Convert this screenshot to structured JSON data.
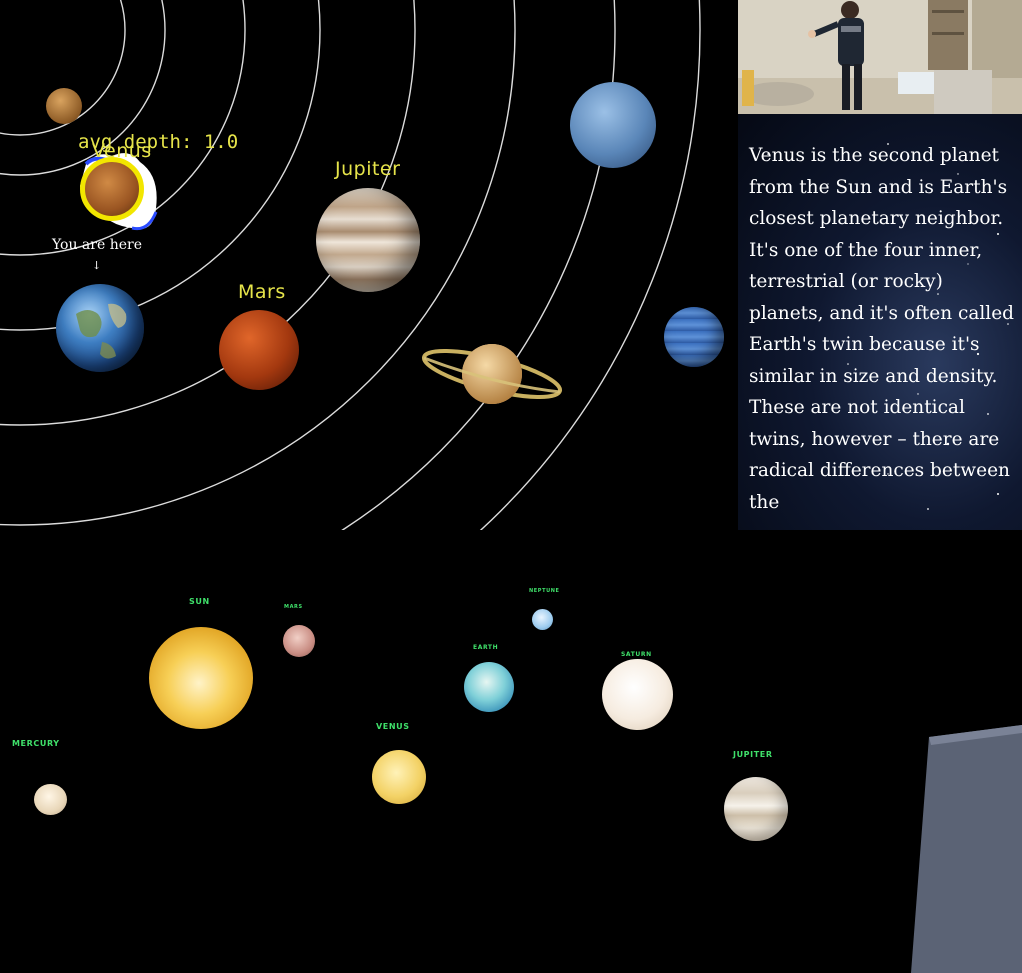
{
  "top_view": {
    "labels": {
      "venus": "Venus",
      "jupiter": "Jupiter",
      "mars": "Mars"
    },
    "avg_depth": "avg depth: 1.0",
    "you_are_here": "You are here",
    "arrow": "↓"
  },
  "info_panel": {
    "text": "Venus is the second planet from the Sun and is Earth's closest planetary neighbor. It's one of the four inner, terrestrial (or rocky) planets, and it's often called Earth's twin because it's similar in size and density. These are not identical twins, however – there are radical differences between the"
  },
  "bottom_view": {
    "labels": {
      "sun": "SUN",
      "mars": "MARS",
      "neptune": "NEPTUNE",
      "earth": "EARTH",
      "saturn": "SATURN",
      "mercury": "MERCURY",
      "venus": "VENUS",
      "jupiter": "JUPITER"
    }
  },
  "colors": {
    "label_yellow": "#e6e44a",
    "label_green": "#3fe06a",
    "orbit_line": "#dcdcdc",
    "highlight_ring": "#f2e600"
  }
}
